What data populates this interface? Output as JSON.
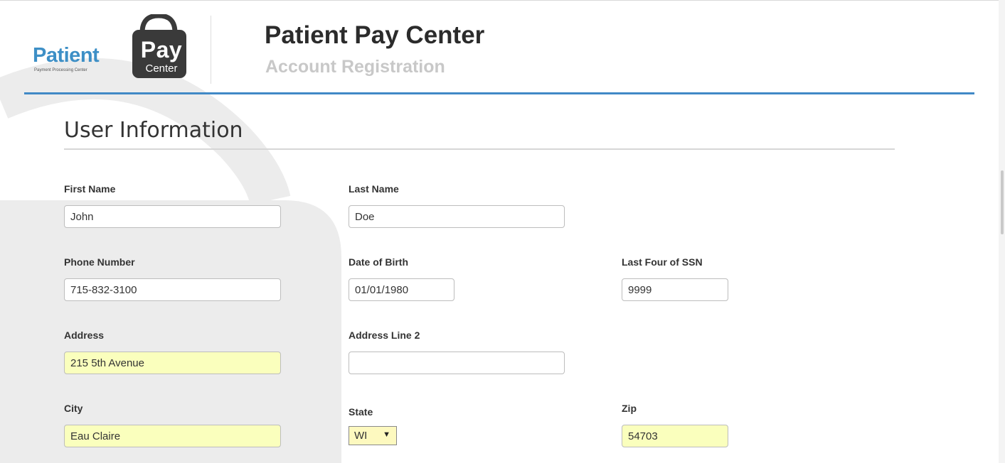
{
  "header": {
    "logo": {
      "patient_text": "Patient",
      "pay_text": "Pay",
      "center_text": "Center",
      "subtitle_text": "Payment Processing Center"
    },
    "title": "Patient Pay Center",
    "subtitle": "Account Registration"
  },
  "section": {
    "title": "User Information"
  },
  "form": {
    "first_name": {
      "label": "First Name",
      "value": "John"
    },
    "last_name": {
      "label": "Last Name",
      "value": "Doe"
    },
    "phone": {
      "label": "Phone Number",
      "value": "715-832-3100"
    },
    "dob": {
      "label": "Date of Birth",
      "value": "01/01/1980"
    },
    "ssn_last4": {
      "label": "Last Four of SSN",
      "value": "9999"
    },
    "address": {
      "label": "Address",
      "value": "215 5th Avenue"
    },
    "address2": {
      "label": "Address Line 2",
      "value": ""
    },
    "city": {
      "label": "City",
      "value": "Eau Claire"
    },
    "state": {
      "label": "State",
      "value": "WI",
      "arrow": "▼"
    },
    "zip": {
      "label": "Zip",
      "value": "54703"
    }
  },
  "colors": {
    "accent": "#4189c6",
    "logo_blue": "#3d8fc6",
    "bag_dark": "#3a3a3a",
    "autofill": "#faffbd",
    "panel_gray": "#ececec"
  },
  "icons": {
    "logo_bag": "shopping-bag-icon",
    "state_dropdown": "chevron-down-icon"
  }
}
